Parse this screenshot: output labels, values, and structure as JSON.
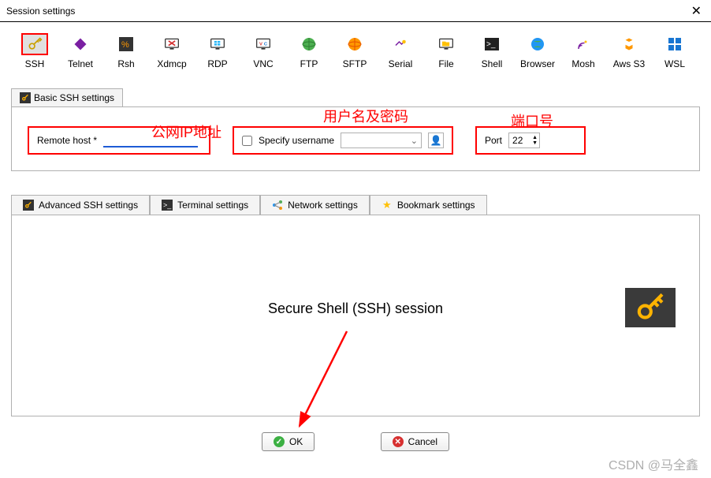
{
  "window": {
    "title": "Session settings"
  },
  "protocols": [
    {
      "id": "ssh",
      "label": "SSH",
      "selected": true
    },
    {
      "id": "telnet",
      "label": "Telnet"
    },
    {
      "id": "rsh",
      "label": "Rsh"
    },
    {
      "id": "xdmcp",
      "label": "Xdmcp"
    },
    {
      "id": "rdp",
      "label": "RDP"
    },
    {
      "id": "vnc",
      "label": "VNC"
    },
    {
      "id": "ftp",
      "label": "FTP"
    },
    {
      "id": "sftp",
      "label": "SFTP"
    },
    {
      "id": "serial",
      "label": "Serial"
    },
    {
      "id": "file",
      "label": "File"
    },
    {
      "id": "shell",
      "label": "Shell"
    },
    {
      "id": "browser",
      "label": "Browser"
    },
    {
      "id": "mosh",
      "label": "Mosh"
    },
    {
      "id": "awss3",
      "label": "Aws S3"
    },
    {
      "id": "wsl",
      "label": "WSL"
    }
  ],
  "basic_tab": {
    "label": "Basic SSH settings"
  },
  "fields": {
    "remote_host_label": "Remote host *",
    "remote_host_value": "",
    "specify_username_label": "Specify username",
    "username_value": "",
    "port_label": "Port",
    "port_value": "22"
  },
  "annotations": {
    "a1": "公网IP地址",
    "a2": "用户名及密码",
    "a3": "端口号"
  },
  "tabs2": [
    {
      "id": "adv",
      "label": "Advanced SSH settings"
    },
    {
      "id": "term",
      "label": "Terminal settings"
    },
    {
      "id": "net",
      "label": "Network settings"
    },
    {
      "id": "bookmark",
      "label": "Bookmark settings"
    }
  ],
  "content": {
    "title": "Secure Shell (SSH) session"
  },
  "buttons": {
    "ok": "OK",
    "cancel": "Cancel"
  },
  "watermark": "CSDN @马全鑫"
}
